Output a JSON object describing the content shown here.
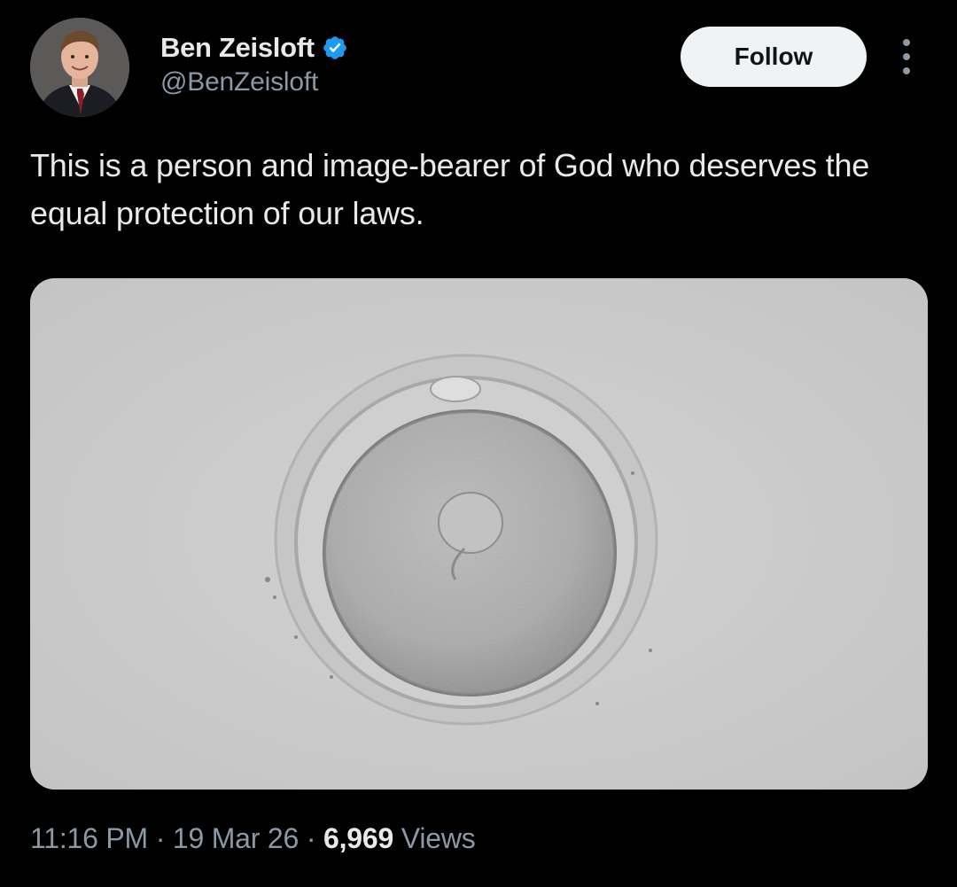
{
  "author": {
    "display_name": "Ben Zeisloft",
    "handle": "@BenZeisloft",
    "verified": true,
    "verified_color": "#1d9bf0",
    "avatar_icon": "profile-photo"
  },
  "actions": {
    "follow_label": "Follow",
    "more_icon": "more-vertical-icon"
  },
  "tweet": {
    "text": "This is a person and image-bearer of God who deserves the equal protection of our laws.",
    "media_kind": "microscope photo of an egg cell"
  },
  "meta": {
    "time": "11:16 PM",
    "separator": " · ",
    "date": "19 Mar 26",
    "views_count": "6,969",
    "views_label": " Views"
  }
}
